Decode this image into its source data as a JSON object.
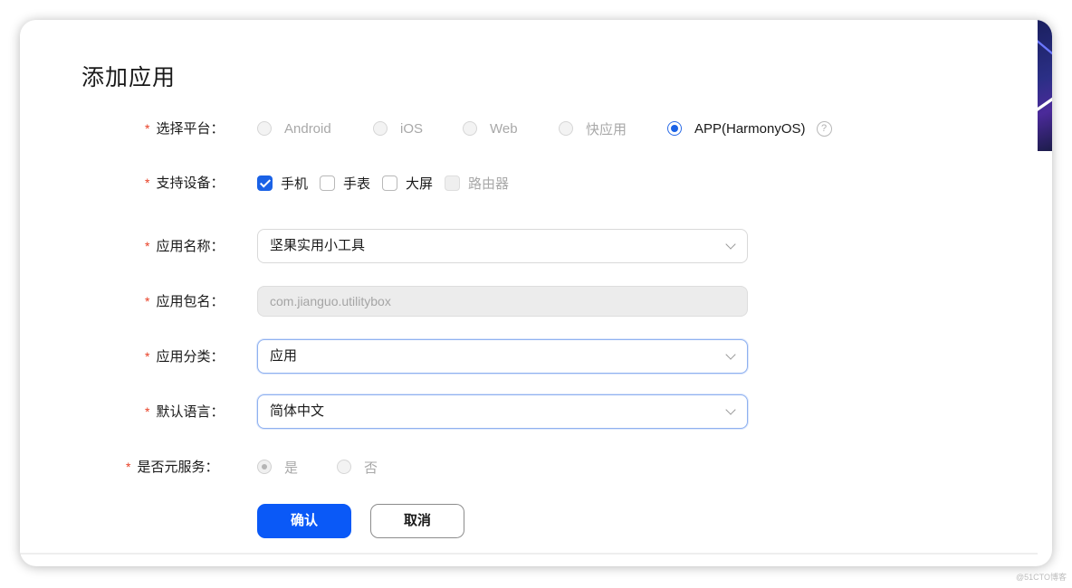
{
  "dialog": {
    "title": "添加应用"
  },
  "platform": {
    "label": "选择平台：",
    "options": [
      {
        "label": "Android",
        "selected": false
      },
      {
        "label": "iOS",
        "selected": false
      },
      {
        "label": "Web",
        "selected": false
      },
      {
        "label": "快应用",
        "selected": false
      },
      {
        "label": "APP(HarmonyOS)",
        "selected": true
      }
    ],
    "help": "?"
  },
  "devices": {
    "label": "支持设备：",
    "options": [
      {
        "label": "手机",
        "checked": true,
        "disabled": false
      },
      {
        "label": "手表",
        "checked": false,
        "disabled": false
      },
      {
        "label": "大屏",
        "checked": false,
        "disabled": false
      },
      {
        "label": "路由器",
        "checked": false,
        "disabled": true
      }
    ]
  },
  "app_name": {
    "label": "应用名称：",
    "value": "坚果实用小工具"
  },
  "package_name": {
    "label": "应用包名：",
    "value": "com.jianguo.utilitybox"
  },
  "category": {
    "label": "应用分类：",
    "value": "应用"
  },
  "language": {
    "label": "默认语言：",
    "value": "简体中文"
  },
  "meta_service": {
    "label": "是否元服务：",
    "options": [
      {
        "label": "是",
        "selected": true
      },
      {
        "label": "否",
        "selected": false
      }
    ]
  },
  "required_mark": "*",
  "buttons": {
    "confirm": "确认",
    "cancel": "取消"
  },
  "watermark": "@51CTO博客",
  "colors": {
    "primary": "#0a59f7",
    "required": "#e84026"
  }
}
